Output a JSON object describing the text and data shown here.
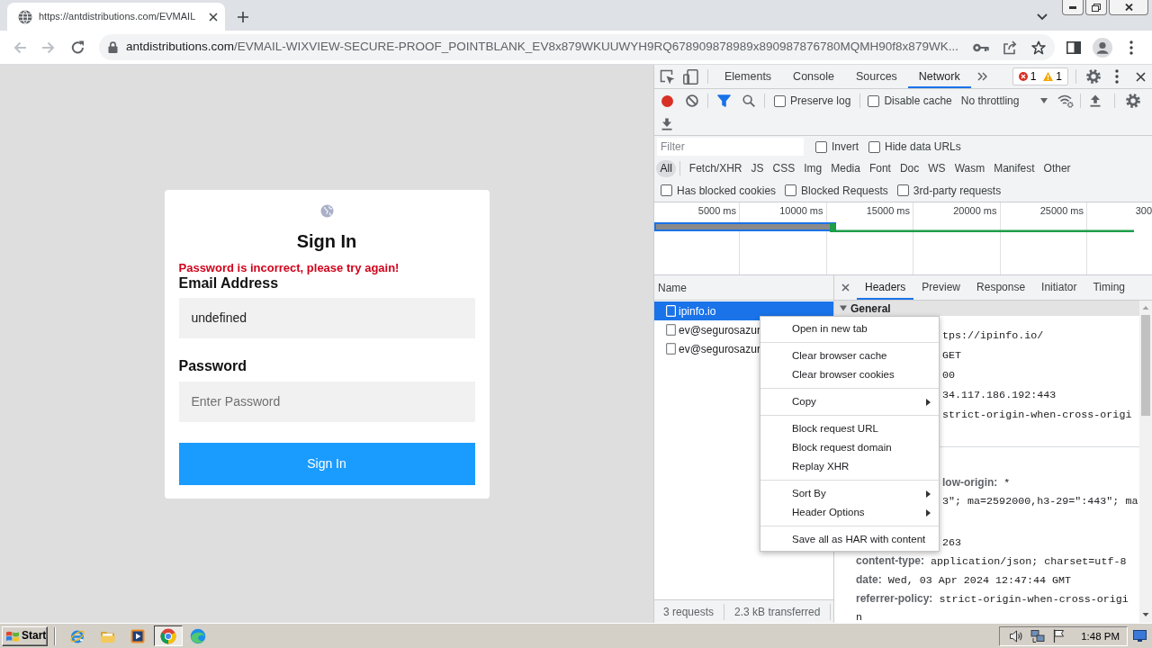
{
  "browser": {
    "tab": {
      "title": "https://antdistributions.com/EVMAIL"
    },
    "back_disabled": true,
    "forward_disabled": true,
    "url_host": "antdistributions.com",
    "url_path": "/EVMAIL-WIXVIEW-SECURE-PROOF_POINTBLANK_EV8x879WKUUWYH9RQ678909878989x890987876780MQMH90f8x879WK..."
  },
  "page": {
    "title": "Sign In",
    "error": "Password is incorrect, please try again!",
    "fields": [
      {
        "label": "Email Address",
        "value": "undefined"
      },
      {
        "label": "Password",
        "placeholder": "Enter Password"
      }
    ],
    "button": "Sign In"
  },
  "devtools": {
    "tabs": [
      {
        "label": "Elements",
        "selected": false
      },
      {
        "label": "Console",
        "selected": false
      },
      {
        "label": "Sources",
        "selected": false
      },
      {
        "label": "Network",
        "selected": true
      }
    ],
    "issues": {
      "errors": "1",
      "warnings": "1"
    },
    "toolbar": {
      "recording": true,
      "filter_active": true,
      "options": [
        {
          "label": "Preserve log",
          "checked": false
        },
        {
          "label": "Disable cache",
          "checked": false
        }
      ],
      "throttling": "No throttling"
    },
    "filter": {
      "placeholder": "Filter",
      "options": [
        {
          "label": "Invert",
          "checked": false
        },
        {
          "label": "Hide data URLs",
          "checked": false
        }
      ]
    },
    "types": [
      {
        "label": "All",
        "selected": true
      },
      {
        "label": "Fetch/XHR",
        "selected": false
      },
      {
        "label": "JS",
        "selected": false
      },
      {
        "label": "CSS",
        "selected": false
      },
      {
        "label": "Img",
        "selected": false
      },
      {
        "label": "Media",
        "selected": false
      },
      {
        "label": "Font",
        "selected": false
      },
      {
        "label": "Doc",
        "selected": false
      },
      {
        "label": "WS",
        "selected": false
      },
      {
        "label": "Wasm",
        "selected": false
      },
      {
        "label": "Manifest",
        "selected": false
      },
      {
        "label": "Other",
        "selected": false
      }
    ],
    "blocked_options": [
      {
        "label": "Has blocked cookies",
        "checked": false
      },
      {
        "label": "Blocked Requests",
        "checked": false
      },
      {
        "label": "3rd-party requests",
        "checked": false
      }
    ],
    "overview": {
      "ticks": [
        "5000 ms",
        "10000 ms",
        "15000 ms",
        "20000 ms",
        "25000 ms",
        "300"
      ]
    },
    "requests": {
      "column": "Name",
      "rows": [
        {
          "name": "ipinfo.io",
          "selected": true
        },
        {
          "name": "ev@segurosazur",
          "selected": false
        },
        {
          "name": "ev@segurosazur",
          "selected": false
        }
      ]
    },
    "summary": [
      "3 requests",
      "2.3 kB transferred"
    ],
    "detail_tabs": [
      {
        "label": "Headers",
        "selected": true
      },
      {
        "label": "Preview",
        "selected": false
      },
      {
        "label": "Response",
        "selected": false
      },
      {
        "label": "Initiator",
        "selected": false
      },
      {
        "label": "Timing",
        "selected": false
      }
    ],
    "general": {
      "title": "General",
      "expanded": true,
      "rows": [
        {
          "value": "tps://ipinfo.io/"
        },
        {
          "value": "GET"
        },
        {
          "value": "00"
        },
        {
          "value": "34.117.186.192:443"
        },
        {
          "value": "strict-origin-when-cross-origi"
        }
      ]
    },
    "response_headers": [
      {
        "kind": "partial",
        "name": "low-origin:",
        "value": "*"
      },
      {
        "kind": "partial",
        "value": "3\"; ma=2592000,h3-29=\":443\"; ma"
      },
      {
        "kind": "partial",
        "value": "263"
      },
      {
        "kind": "full",
        "name": "content-type:",
        "value": "application/json; charset=utf-8"
      },
      {
        "kind": "full",
        "name": "date:",
        "value": "Wed, 03 Apr 2024 12:47:44 GMT"
      },
      {
        "kind": "full",
        "name": "referrer-policy:",
        "value": "strict-origin-when-cross-origin"
      }
    ]
  },
  "context_menu": [
    [
      {
        "label": "Open in new tab",
        "submenu": false
      }
    ],
    [
      {
        "label": "Clear browser cache",
        "submenu": false
      },
      {
        "label": "Clear browser cookies",
        "submenu": false
      }
    ],
    [
      {
        "label": "Copy",
        "submenu": true
      }
    ],
    [
      {
        "label": "Block request URL",
        "submenu": false
      },
      {
        "label": "Block request domain",
        "submenu": false
      },
      {
        "label": "Replay XHR",
        "submenu": false
      }
    ],
    [
      {
        "label": "Sort By",
        "submenu": true
      },
      {
        "label": "Header Options",
        "submenu": true
      }
    ],
    [
      {
        "label": "Save all as HAR with content",
        "submenu": false
      }
    ]
  ],
  "taskbar": {
    "start": "Start",
    "apps": [
      {
        "active": false
      },
      {
        "active": false
      },
      {
        "active": false
      },
      {
        "active": true
      },
      {
        "active": false
      }
    ],
    "clock": "1:48 PM"
  }
}
